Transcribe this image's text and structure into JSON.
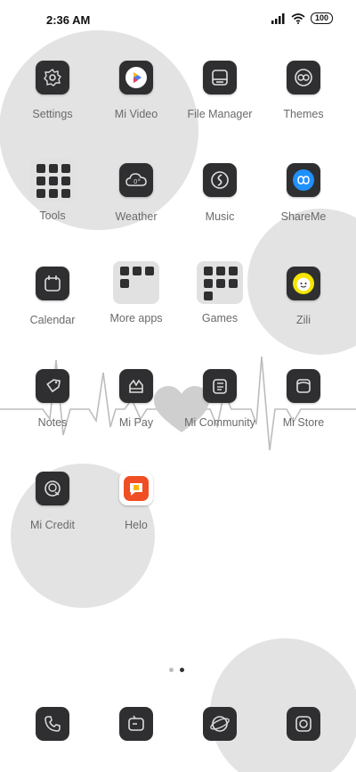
{
  "status": {
    "time": "2:36 AM",
    "battery": "100"
  },
  "apps": {
    "settings": "Settings",
    "mi_video": "Mi Video",
    "file_manager": "File Manager",
    "themes": "Themes",
    "tools": "Tools",
    "weather": "Weather",
    "music": "Music",
    "shareme": "ShareMe",
    "calendar": "Calendar",
    "more_apps": "More apps",
    "games": "Games",
    "zili": "Zili",
    "notes": "Notes",
    "mi_pay": "Mi Pay",
    "mi_community": "Mi Community",
    "mi_store": "Mi Store",
    "mi_credit": "Mi Credit",
    "helo": "Helo"
  },
  "dock": [
    "phone-icon",
    "messaging-icon",
    "browser-icon",
    "camera-icon"
  ],
  "pager": {
    "pages": 2,
    "active": 2
  },
  "colors": {
    "tile": "#2f2f31",
    "wallpaper_circle": "#e2e2e2",
    "label": "#6a6a6a"
  }
}
